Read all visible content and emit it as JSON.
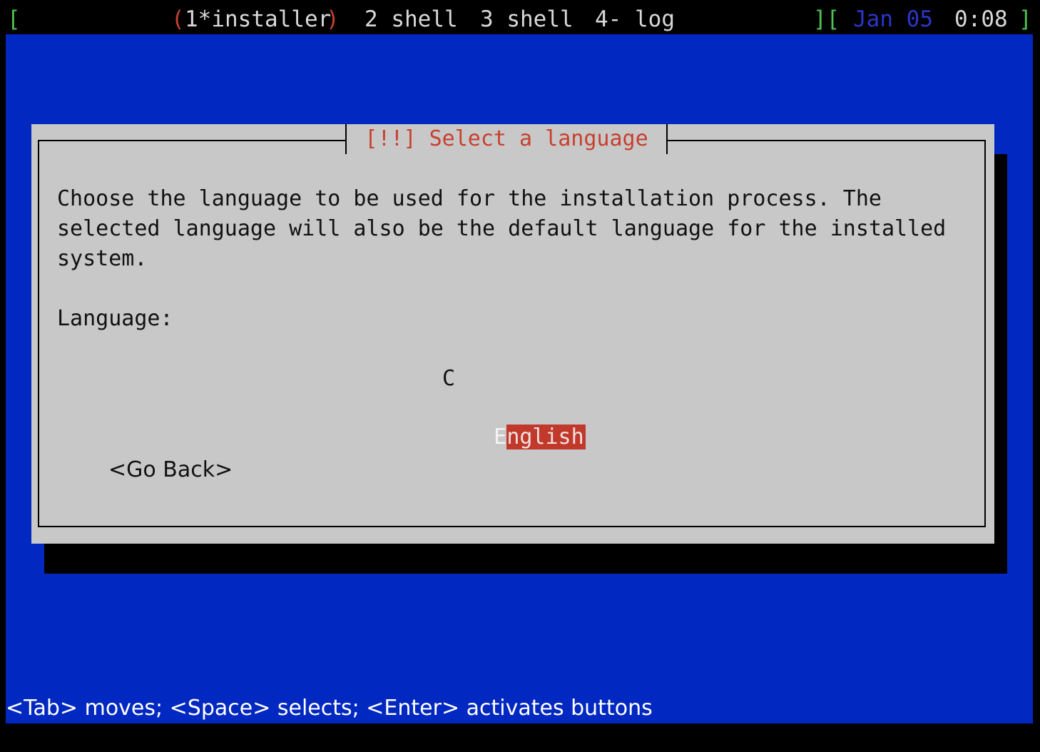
{
  "status_bar": {
    "left_bracket": "[",
    "windows": [
      {
        "label": "1*installer",
        "active": true
      },
      {
        "label": "2 shell",
        "active": false
      },
      {
        "label": "3 shell",
        "active": false
      },
      {
        "label": "4- log",
        "active": false
      }
    ],
    "active_open": "(",
    "active_close": ")",
    "right_brackets": "][",
    "date": "Jan 05",
    "time": "0:08",
    "right_close": "]"
  },
  "dialog": {
    "title": "[!!] Select a language",
    "description_lines": [
      "Choose the language to be used for the installation process. The",
      "selected language will also be the default language for the installed",
      "system."
    ],
    "field_label": "Language:",
    "options": [
      "C",
      "English"
    ],
    "selected_option": "English",
    "selected_first_char": "E",
    "selected_rest": "nglish",
    "go_back_button": "<Go Back>"
  },
  "help_line": "<Tab> moves; <Space> selects; <Enter> activates buttons",
  "colors": {
    "background_blue": "#0128c0",
    "dialog_gray": "#c8c8c8",
    "title_red": "#c8402f",
    "selection_red": "#c0392b",
    "status_green": "#4ec24e",
    "status_date_blue": "#2a36c9"
  }
}
